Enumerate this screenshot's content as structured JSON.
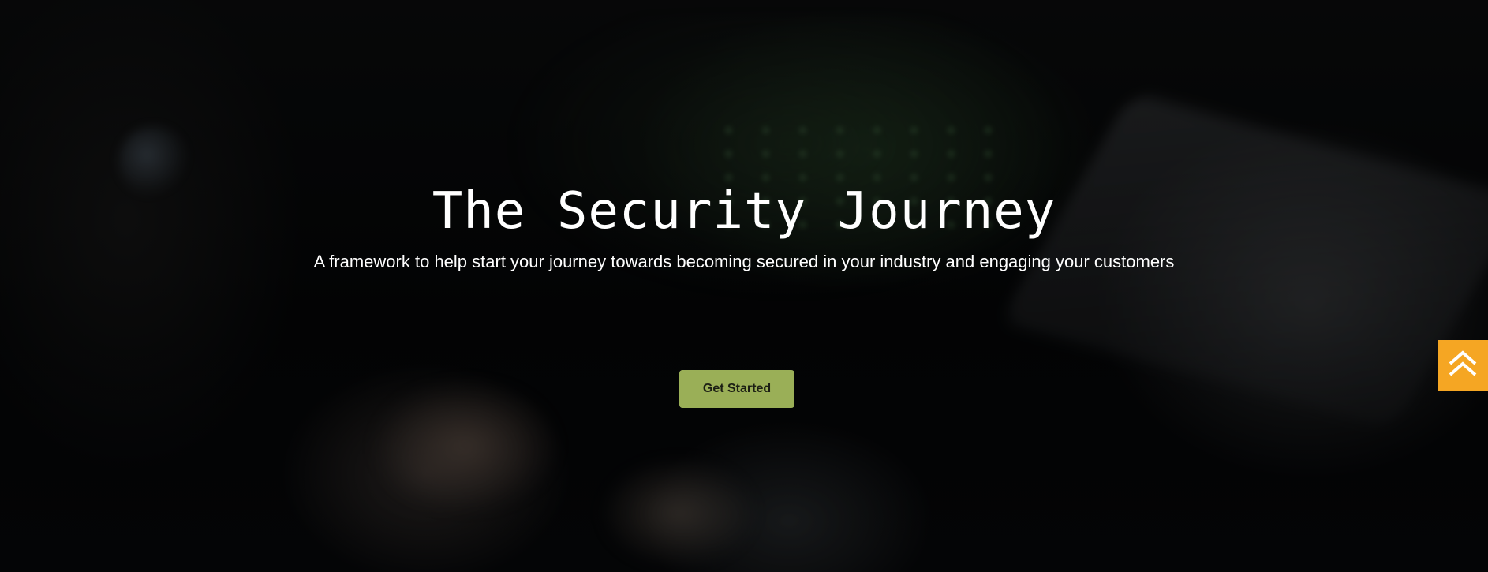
{
  "hero": {
    "title": "The Security Journey",
    "subtitle": "A framework to help start your journey towards becoming secured in your industry and engaging your customers",
    "cta_label": "Get Started"
  },
  "scroll_top": {
    "icon": "double-chevron-up-icon"
  },
  "colors": {
    "cta_background": "#9aaf57",
    "scroll_top_background": "#f5a623",
    "text": "#ffffff"
  }
}
